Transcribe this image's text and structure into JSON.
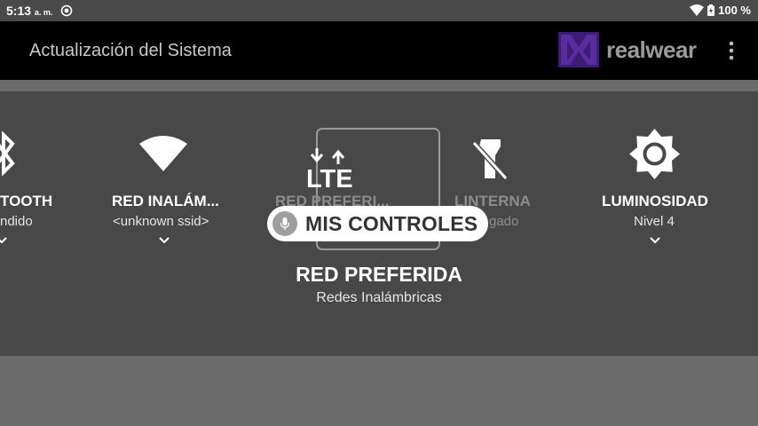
{
  "status_bar": {
    "time": "5:13",
    "ampm": "a. m.",
    "battery": "100 %"
  },
  "app_bar": {
    "title": "Actualización del Sistema",
    "logo_text": "realwear"
  },
  "tiles": [
    {
      "label": "TOOTH",
      "sub": "ndido",
      "icon": "bluetooth-icon"
    },
    {
      "label": "RED INALÁM...",
      "sub": "<unknown ssid>",
      "icon": "wifi-icon"
    },
    {
      "label": "RED PREFERI...",
      "sub": "",
      "icon": "lte-icon",
      "icon_text": "LTE"
    },
    {
      "label": "LINTERNA",
      "sub": "gado",
      "icon": "flashlight-off-icon"
    },
    {
      "label": "LUMINOSIDAD",
      "sub": "Nivel 4",
      "icon": "brightness-icon"
    }
  ],
  "voice": {
    "label": "MIS CONTROLES"
  },
  "detail": {
    "title": "RED PREFERIDA",
    "subtitle": "Redes Inalámbricas"
  },
  "colors": {
    "panel": "#484848",
    "app_bar": "#000000",
    "logo_purple": "#5a2ca0"
  }
}
